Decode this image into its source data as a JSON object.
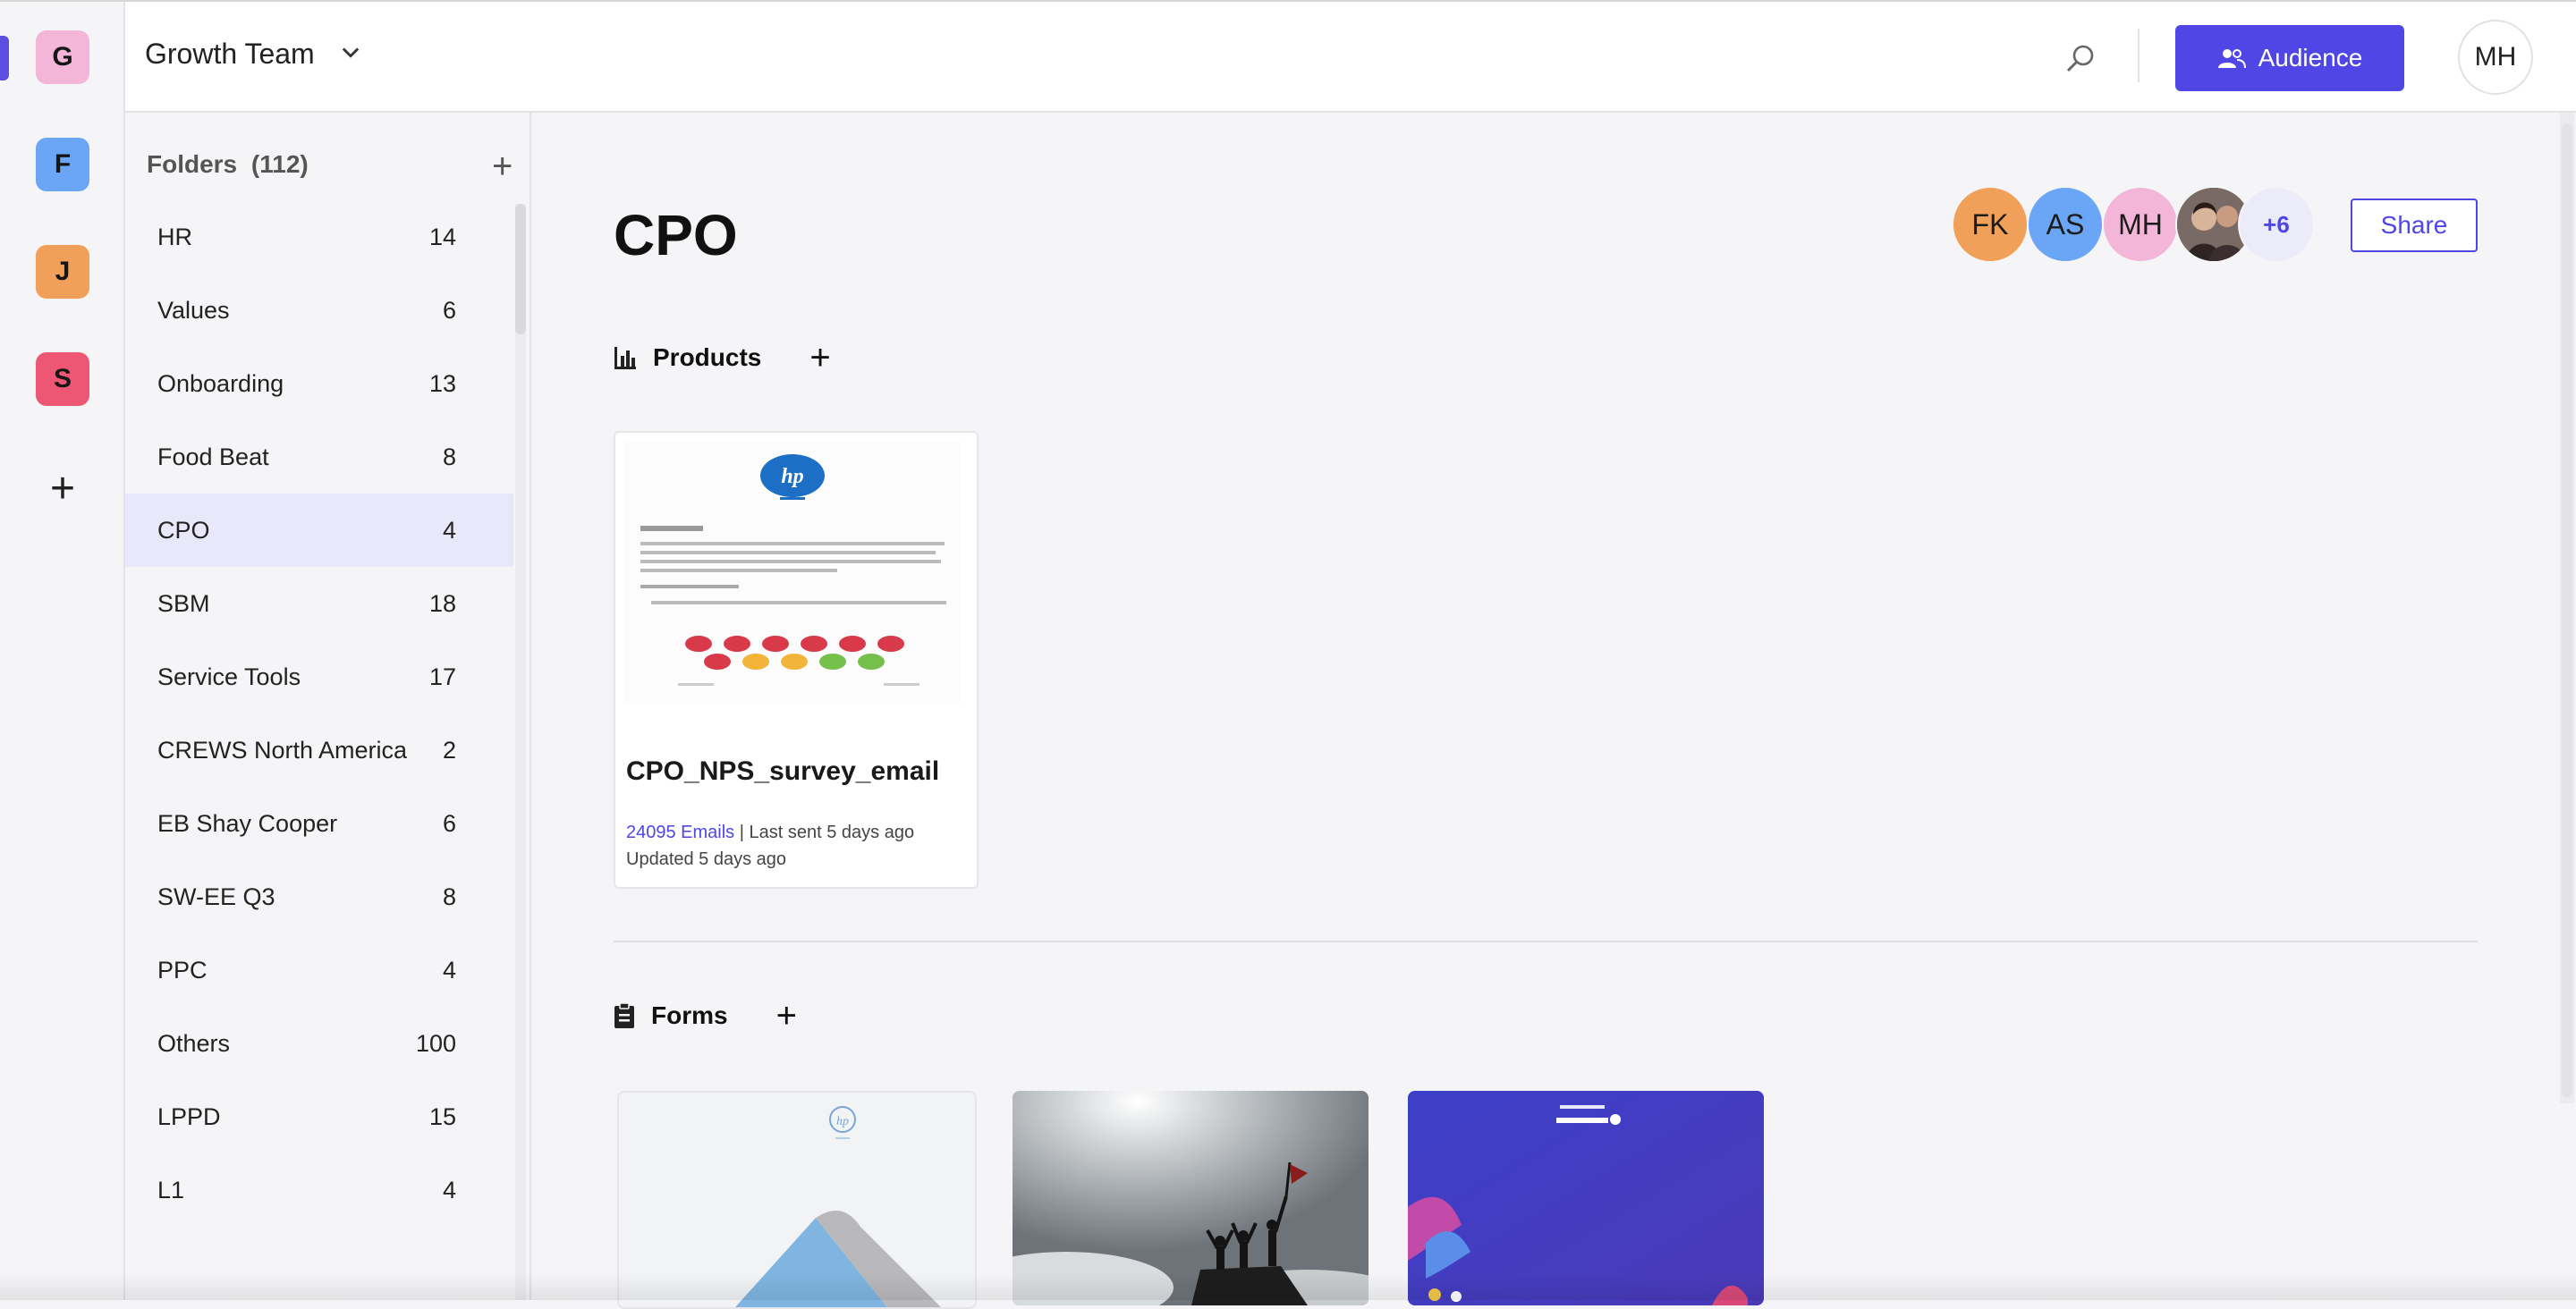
{
  "workspaces": [
    {
      "letter": "G",
      "color": "#f3b6d8"
    },
    {
      "letter": "F",
      "color": "#6aa6f5"
    },
    {
      "letter": "J",
      "color": "#f0a058"
    },
    {
      "letter": "S",
      "color": "#ee5774"
    }
  ],
  "header": {
    "team_name": "Growth Team",
    "audience_label": "Audience",
    "user_initials": "MH"
  },
  "folders": {
    "title": "Folders",
    "count": "(112)",
    "items": [
      {
        "name": "HR",
        "count": "14"
      },
      {
        "name": "Values",
        "count": "6"
      },
      {
        "name": "Onboarding",
        "count": "13"
      },
      {
        "name": "Food Beat",
        "count": "8"
      },
      {
        "name": "CPO",
        "count": "4"
      },
      {
        "name": "SBM",
        "count": "18"
      },
      {
        "name": "Service Tools",
        "count": "17"
      },
      {
        "name": "CREWS North America",
        "count": "2"
      },
      {
        "name": "EB Shay Cooper",
        "count": "6"
      },
      {
        "name": "SW-EE Q3",
        "count": "8"
      },
      {
        "name": "PPC",
        "count": "4"
      },
      {
        "name": "Others",
        "count": "100"
      },
      {
        "name": "LPPD",
        "count": "15"
      },
      {
        "name": "L1",
        "count": "4"
      }
    ]
  },
  "main": {
    "title": "CPO",
    "collaborators": [
      {
        "initials": "FK",
        "color": "#f0a058"
      },
      {
        "initials": "AS",
        "color": "#6aa6f5"
      },
      {
        "initials": "MH",
        "color": "#f3b6d8"
      }
    ],
    "more_collaborators": "+6",
    "share_label": "Share",
    "products_label": "Products",
    "forms_label": "Forms",
    "product_card": {
      "title": "CPO_NPS_survey_email",
      "emails": "24095 Emails",
      "last_sent": " | Last sent 5 days ago",
      "updated": "Updated 5 days ago"
    }
  },
  "colors": {
    "accent": "#4f46e5",
    "active_folder_bg": "#e9e8fb"
  }
}
